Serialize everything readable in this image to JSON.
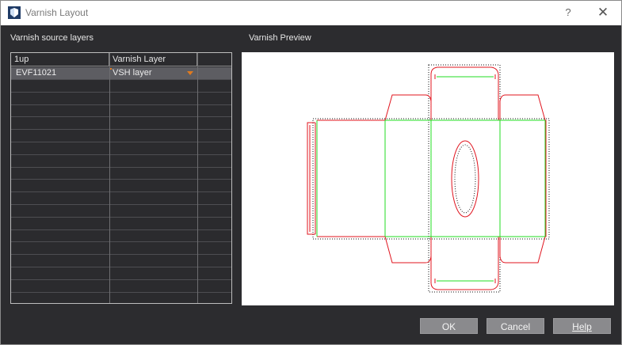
{
  "window": {
    "title": "Varnish Layout",
    "help_label": "?",
    "close_label": "✕"
  },
  "left_panel": {
    "label": "Varnish source layers",
    "columns": [
      "1up",
      "Varnish Layer",
      ""
    ],
    "rows": [
      {
        "oneup": "EVF11021",
        "varnish_layer": "VSH layer"
      }
    ]
  },
  "right_panel": {
    "label": "Varnish Preview"
  },
  "buttons": {
    "ok": "OK",
    "cancel": "Cancel",
    "help": "Help"
  },
  "colors": {
    "cut_line": "#e0141e",
    "crease_line": "#22dd22",
    "accent": "#e07a1f"
  }
}
